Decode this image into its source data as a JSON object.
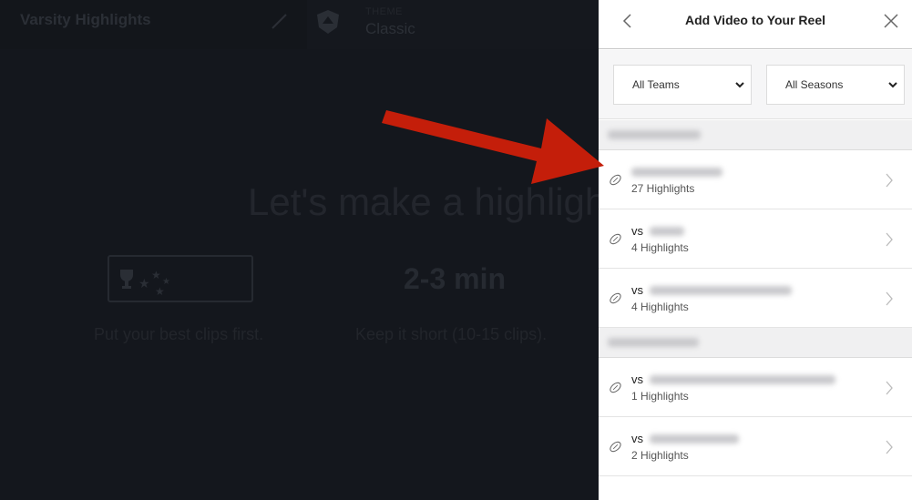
{
  "background": {
    "app_title": "Varsity Highlights",
    "theme_label": "THEME",
    "theme_value": "Classic",
    "heading": "Let's make a highlight r",
    "duration": "2-3 min",
    "tip_1": "Put your best clips first.",
    "tip_2": "Keep it short (10-15 clips)."
  },
  "panel": {
    "title": "Add Video to Your Reel",
    "back_icon": "chevron-left-icon",
    "close_icon": "close-icon",
    "filters": {
      "teams": {
        "selected": "All Teams"
      },
      "seasons": {
        "selected": "All Seasons"
      }
    },
    "sections": [
      {
        "label_redacted": true,
        "rows": [
          {
            "prefix": "",
            "opponent_redacted": true,
            "count": "27 Highlights"
          },
          {
            "prefix": "vs",
            "opponent_redacted": true,
            "count": "4 Highlights"
          },
          {
            "prefix": "vs",
            "opponent_redacted": true,
            "count": "4 Highlights"
          }
        ]
      },
      {
        "label_redacted": true,
        "rows": [
          {
            "prefix": "vs",
            "opponent_redacted": true,
            "count": "1 Highlights"
          },
          {
            "prefix": "vs",
            "opponent_redacted": true,
            "count": "2 Highlights"
          }
        ]
      }
    ]
  },
  "annotation": {
    "type": "arrow",
    "color": "#c41e0a"
  },
  "colors": {
    "overlay_bg": "#14171d",
    "panel_bg": "#ffffff",
    "section_bg": "#f0f0f1",
    "arrow": "#c41e0a"
  }
}
